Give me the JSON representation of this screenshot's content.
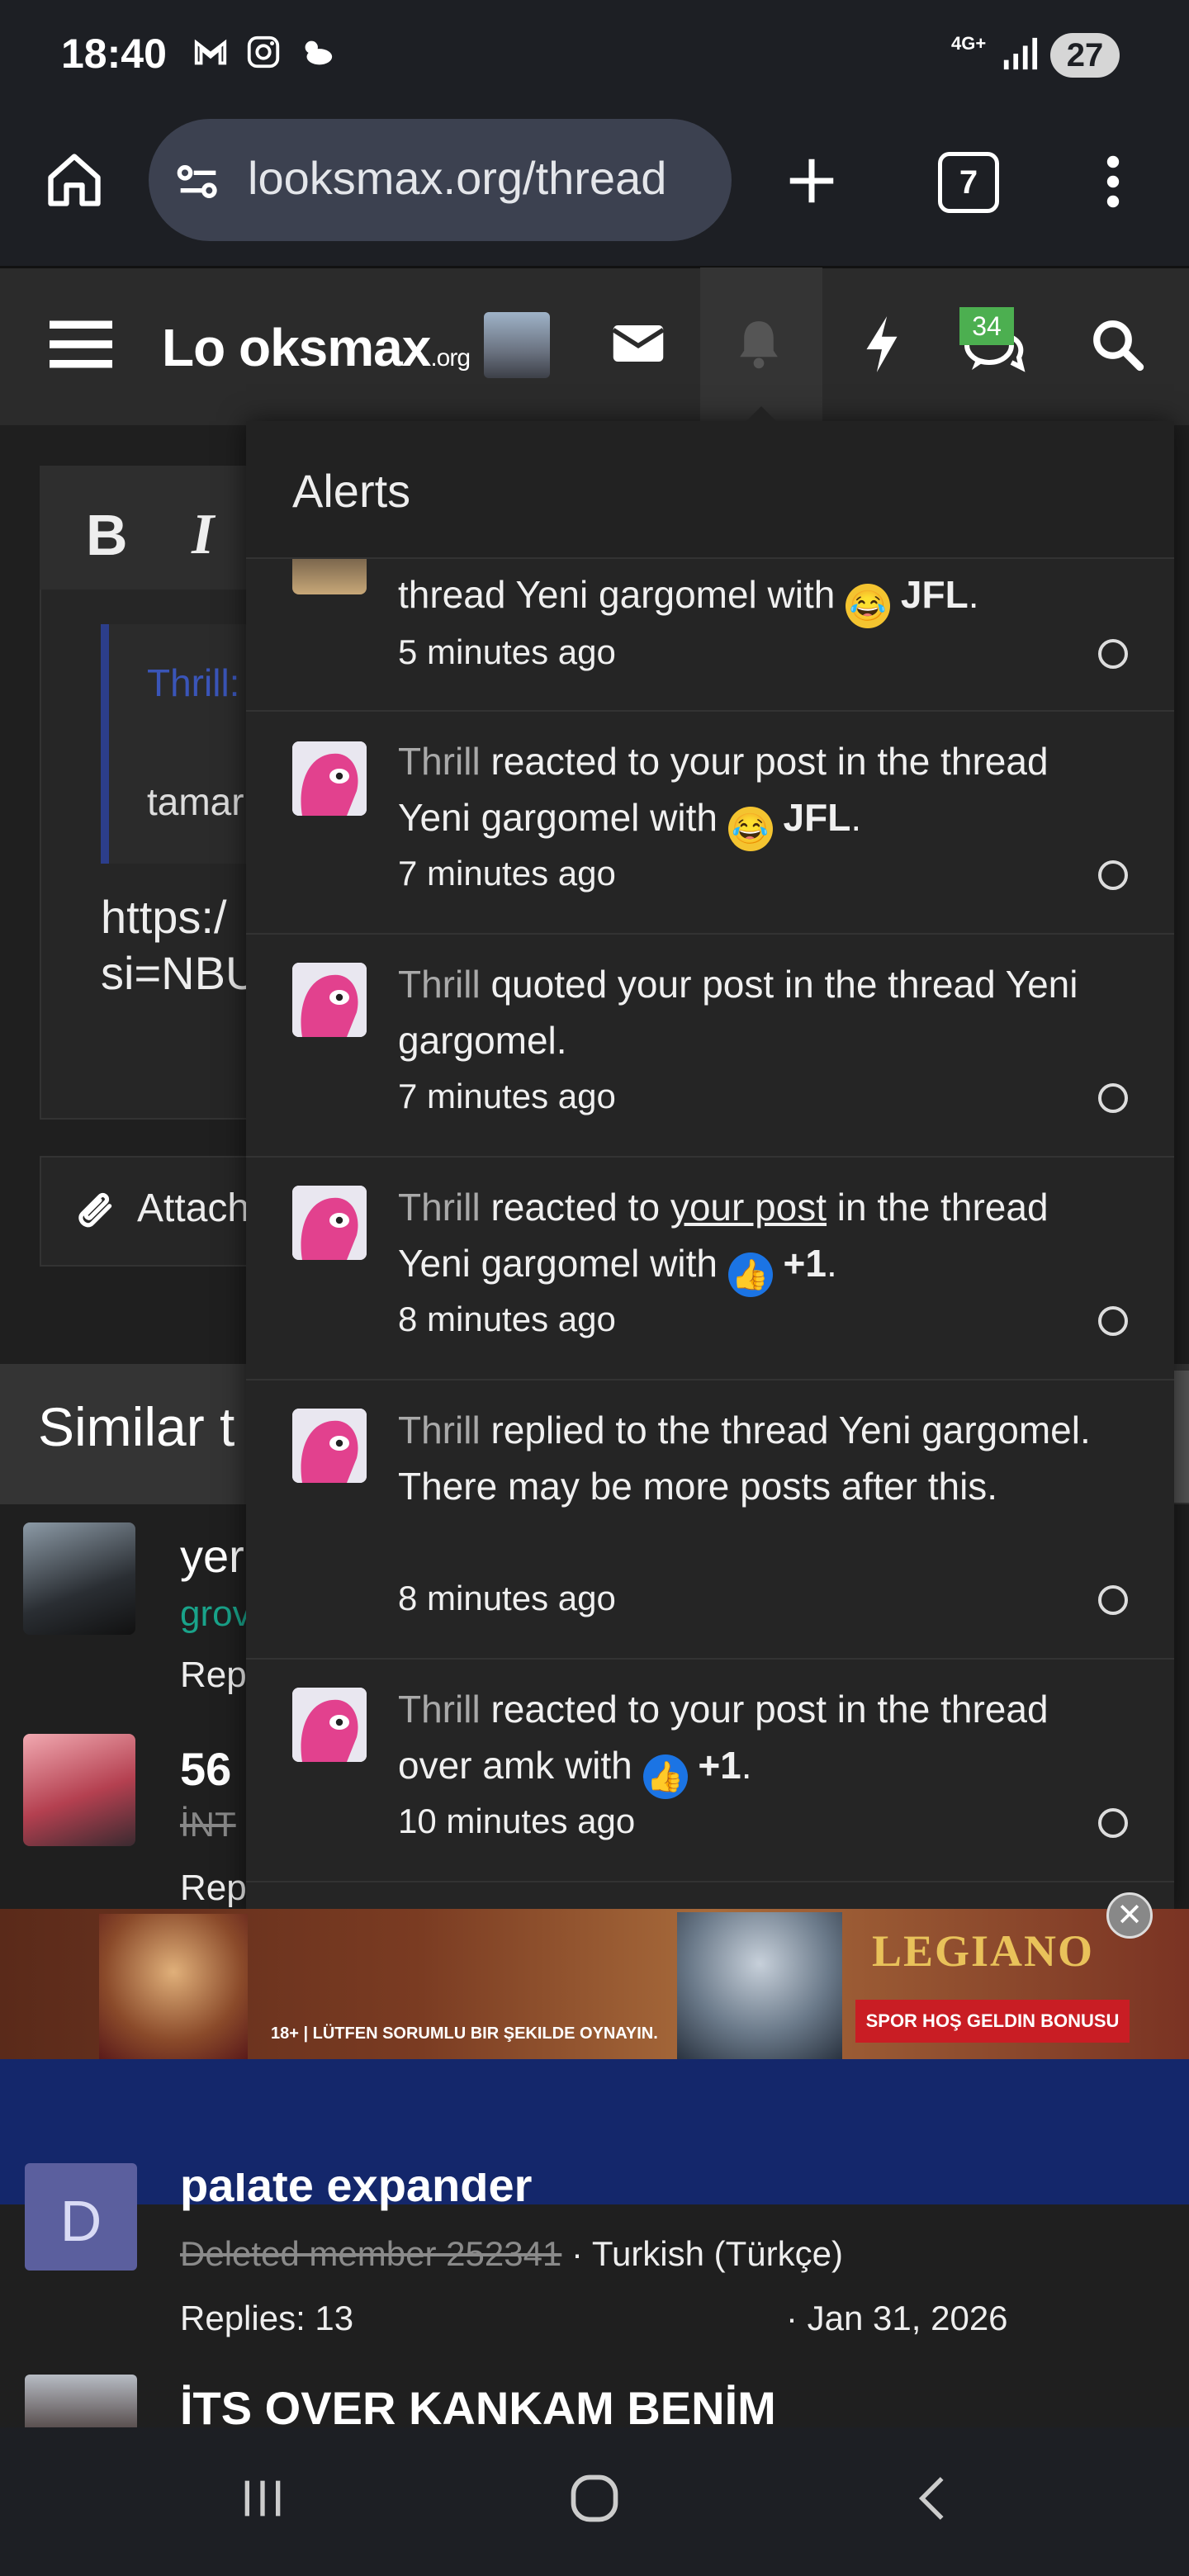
{
  "status_bar": {
    "time": "18:40",
    "network": "4G+",
    "battery": "27"
  },
  "browser": {
    "url": "looksmax.org/thread",
    "tab_count": "7"
  },
  "site": {
    "logo_main": "Lo oksmax",
    "logo_suffix": ".org",
    "chat_badge": "34"
  },
  "editor": {
    "quote_author": "Thrill:",
    "quote_text": "tamar",
    "body_line1": "https:/",
    "body_line2": "si=NBU",
    "attach_label": "Attach"
  },
  "similar": {
    "title": "Similar t",
    "items": [
      {
        "title": "yer",
        "prefix": "grov",
        "meta": "Rep"
      },
      {
        "title": "56",
        "prefix": "İNT",
        "meta": "Rep"
      }
    ]
  },
  "alerts": {
    "title": "Alerts",
    "items": [
      {
        "user": "",
        "text": "thread Yeni gargomel with",
        "reaction": "JFL",
        "suffix": ".",
        "time": "5 minutes ago"
      },
      {
        "user": "Thrill",
        "text": " reacted to your post in the thread Yeni gargomel with",
        "reaction": "JFL",
        "suffix": ".",
        "time": "7 minutes ago"
      },
      {
        "user": "Thrill",
        "text": " quoted your post in the thread Yeni gargomel.",
        "reaction": "",
        "suffix": "",
        "time": "7 minutes ago"
      },
      {
        "user": "Thrill",
        "text_a": " reacted to ",
        "link": "your post",
        "text_b": " in the thread Yeni gargomel with",
        "reaction": "+1",
        "suffix": ".",
        "time": "8 minutes ago"
      },
      {
        "user": "Thrill",
        "text": " replied to the thread Yeni gargomel. There may be more posts after this.",
        "reaction": "",
        "suffix": "",
        "time": "8 minutes ago"
      },
      {
        "user": "Thrill",
        "text": " reacted to your post in the thread over amk with",
        "reaction": "+1",
        "suffix": ".",
        "time": "10 minutes ago"
      }
    ]
  },
  "ad": {
    "brand": "LEGIANO",
    "bonus": "SPOR HOŞ GELDIN BONUSU",
    "disclaimer": "18+ | LÜTFEN SORUMLU BIR ŞEKILDE OYNAYIN."
  },
  "threads": [
    {
      "title": "palate expander",
      "author": "Deleted member 252341",
      "forum": " · Turkish (Türkçe)",
      "replies": "Replies: 13",
      "date": "· Jan 31, 2026",
      "avatar_letter": "D"
    },
    {
      "title": "İTS OVER KANKAM BENİM"
    }
  ]
}
